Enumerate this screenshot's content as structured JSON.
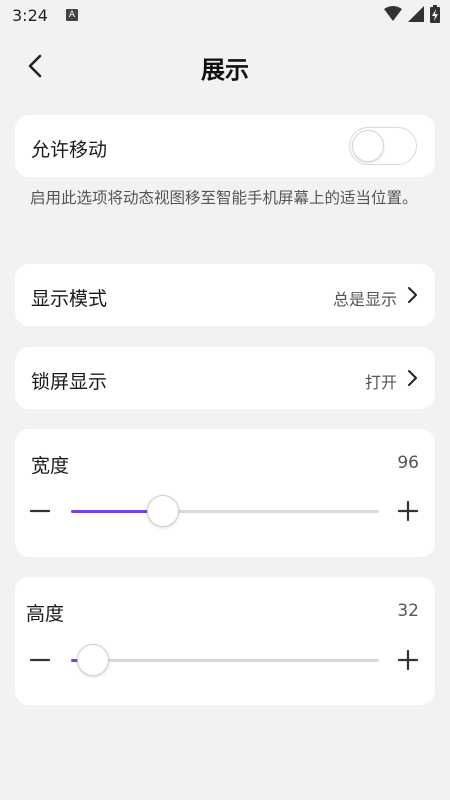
{
  "status_bar": {
    "time": "3:24",
    "notification_icon": "A"
  },
  "header": {
    "title": "展示"
  },
  "allow_move": {
    "label": "允许移动",
    "enabled": false,
    "help_text": "启用此选项将动态视图移至智能手机屏幕上的适当位置。"
  },
  "display_mode": {
    "label": "显示模式",
    "value": "总是显示"
  },
  "lock_screen": {
    "label": "锁屏显示",
    "value": "打开"
  },
  "width": {
    "label": "宽度",
    "value": "96",
    "fraction": 0.3
  },
  "height": {
    "label": "高度",
    "value": "32",
    "fraction": 0.07
  },
  "colors": {
    "accent": "#7b3fe4",
    "background": "#f2f2f4",
    "card": "#ffffff"
  }
}
